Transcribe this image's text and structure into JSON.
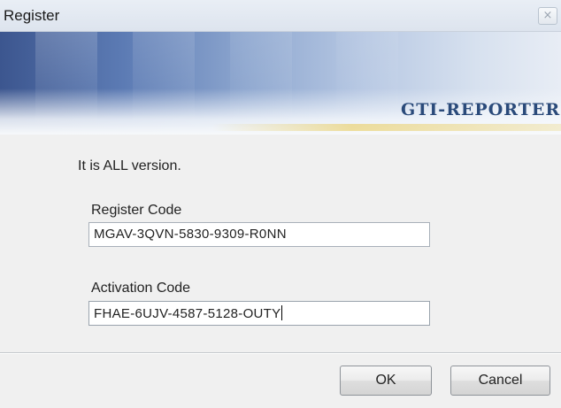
{
  "window": {
    "title": "Register",
    "close_label": "×"
  },
  "banner": {
    "product": "GTI-REPORTER"
  },
  "body": {
    "info_text": "It is ALL version."
  },
  "register": {
    "label": "Register Code",
    "value": "MGAV-3QVN-5830-9309-R0NN"
  },
  "activation": {
    "label": "Activation Code",
    "value": "FHAE-6UJV-4587-5128-OUTY"
  },
  "buttons": {
    "ok": "OK",
    "cancel": "Cancel"
  }
}
